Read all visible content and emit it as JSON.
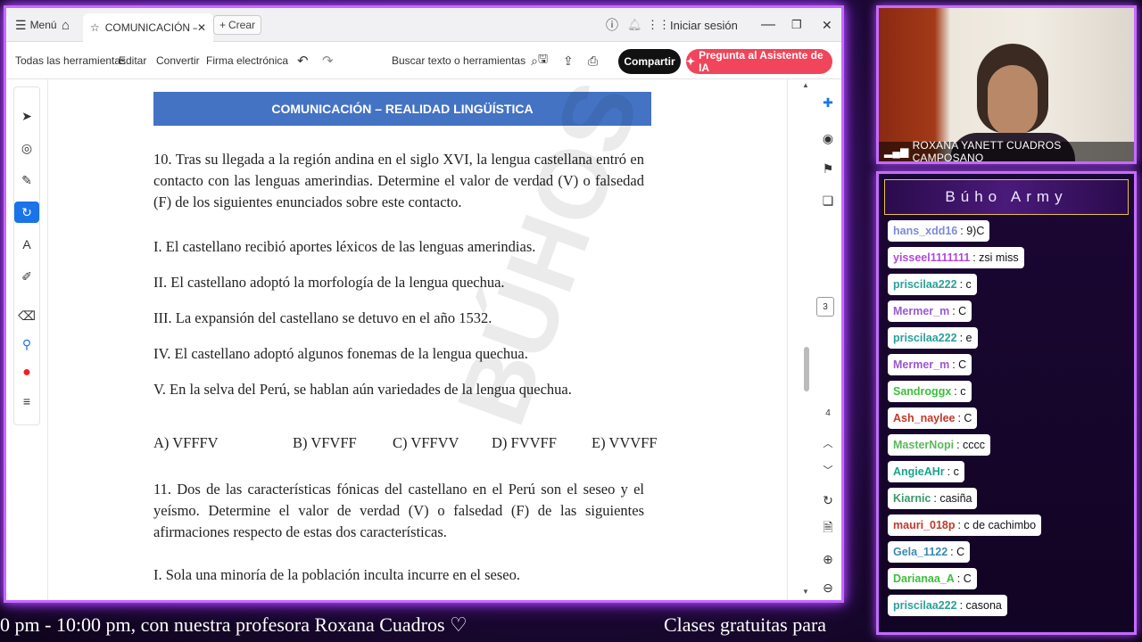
{
  "browser": {
    "menu_label": "Menú",
    "tab_title": "COMUNICACIÓN – ...",
    "new_tab_label": "Crear",
    "signin_label": "Iniciar sesión"
  },
  "toolbar": {
    "all_tools": "Todas las herramientas",
    "edit": "Editar",
    "convert": "Convertir",
    "esign": "Firma electrónica",
    "search_placeholder": "Buscar texto o herramientas",
    "share": "Compartir",
    "ai_assistant": "Pregunta al Asistente de IA"
  },
  "document": {
    "header": "COMUNICACIÓN – REALIDAD LINGÜÍSTICA",
    "q10": "10. Tras su llegada a la región andina en el siglo XVI, la lengua castellana entró en contacto con las lenguas amerindias. Determine el valor de verdad (V) o falsedad (F) de los siguientes enunciados sobre este contacto.",
    "statements": [
      "I. El castellano recibió aportes léxicos de las lenguas amerindias.",
      "II. El castellano adoptó la morfología de la lengua quechua.",
      "III. La expansión del castellano se detuvo en el año 1532.",
      "IV. El castellano adoptó algunos fonemas de la lengua quechua.",
      "V. En la selva del Perú, se hablan aún variedades de la lengua quechua."
    ],
    "options": [
      "A) VFFFV",
      "B) VFVFF",
      "C) VFFVV",
      "D) FVVFF",
      "E) VVVFF"
    ],
    "q11": "11. Dos de las características fónicas del castellano en el Perú son el seseo y el yeísmo. Determine el valor de verdad (V) o falsedad (F) de las siguientes afirmaciones respecto de estas dos características.",
    "q11_item1": "I. Sola una minoría de la población inculta incurre en el seseo.",
    "watermark": "BÚHOS"
  },
  "page_indicator": {
    "current": "3",
    "next": "4"
  },
  "camera": {
    "name": "ROXANA YANETT CUADROS CAMPOSANO"
  },
  "chat": {
    "title": "Búho Army",
    "messages": [
      {
        "user": "hans_xdd16",
        "text": ": 9)C",
        "color": "#7b8bd8"
      },
      {
        "user": "yisseel1111111",
        "text": ": zsi miss",
        "color": "#b048d8"
      },
      {
        "user": "priscilaa222",
        "text": ": c",
        "color": "#2aa198"
      },
      {
        "user": "Mermer_m",
        "text": ": C",
        "color": "#9b59d0"
      },
      {
        "user": "priscilaa222",
        "text": ": e",
        "color": "#2aa198"
      },
      {
        "user": "Mermer_m",
        "text": ": C",
        "color": "#9b59d0"
      },
      {
        "user": "Sandroggx",
        "text": ": c",
        "color": "#3cbf3c"
      },
      {
        "user": "Ash_naylee",
        "text": ": C",
        "color": "#c0392b"
      },
      {
        "user": "MasterNopi",
        "text": ": cccc",
        "color": "#5cb85c"
      },
      {
        "user": "AngieAHr",
        "text": ": c",
        "color": "#1aa38a"
      },
      {
        "user": "Kiarnic",
        "text": ": casiña",
        "color": "#3a9a6a"
      },
      {
        "user": "mauri_018p",
        "text": ": c de cachimbo",
        "color": "#c0392b"
      },
      {
        "user": "Gela_1122",
        "text": ": C",
        "color": "#3a8ab0"
      },
      {
        "user": "Darianaa_A",
        "text": ": C",
        "color": "#3cbf3c"
      },
      {
        "user": "priscilaa222",
        "text": ": casona",
        "color": "#2aa198"
      }
    ]
  },
  "ticker": {
    "left": "0 pm - 10:00 pm, con nuestra profesora Roxana Cuadros ♡",
    "right": "Clases gratuitas para"
  }
}
